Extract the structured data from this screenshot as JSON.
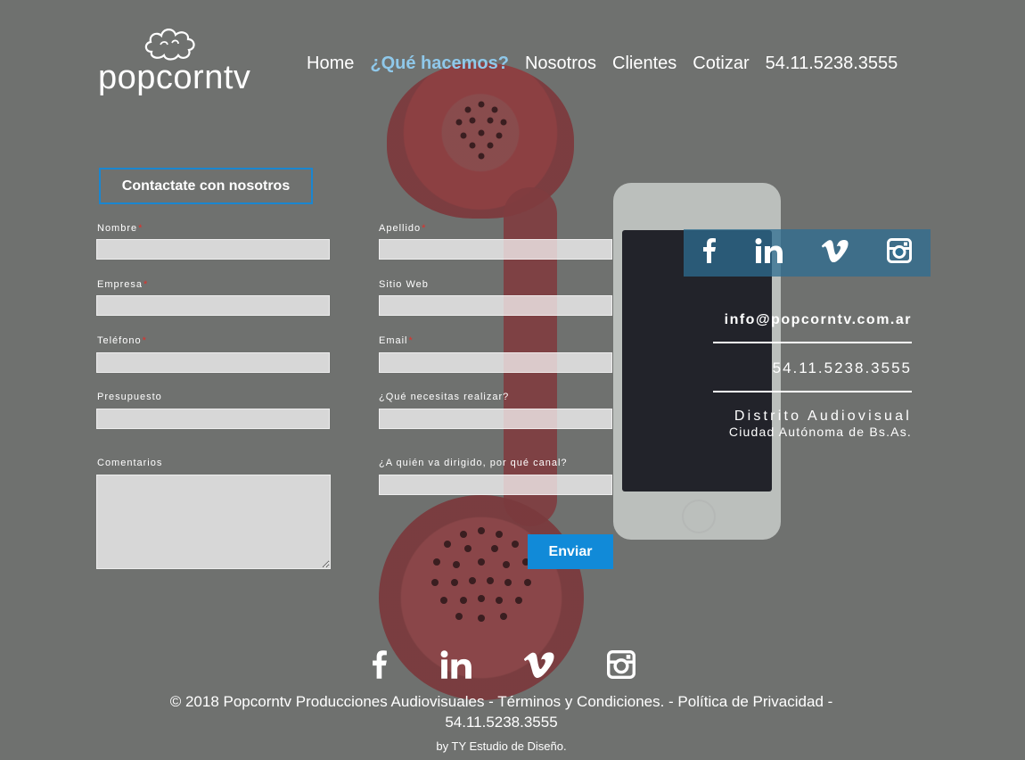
{
  "brand": {
    "name": "popcorntv"
  },
  "nav": {
    "items": [
      {
        "label": "Home"
      },
      {
        "label": "¿Qué hacemos?"
      },
      {
        "label": "Nosotros"
      },
      {
        "label": "Clientes"
      },
      {
        "label": "Cotizar"
      },
      {
        "label": "54.11.5238.3555"
      }
    ],
    "active": "¿Qué hacemos?"
  },
  "form": {
    "title": "Contactate con nosotros",
    "fields": {
      "nombre": {
        "label": "Nombre",
        "required": true,
        "value": ""
      },
      "apellido": {
        "label": "Apellido",
        "required": true,
        "value": ""
      },
      "empresa": {
        "label": "Empresa",
        "required": true,
        "value": ""
      },
      "sitio_web": {
        "label": "Sitio Web",
        "required": false,
        "value": ""
      },
      "telefono": {
        "label": "Teléfono",
        "required": true,
        "value": ""
      },
      "email": {
        "label": "Email",
        "required": true,
        "value": ""
      },
      "presupuesto": {
        "label": "Presupuesto",
        "required": false,
        "value": ""
      },
      "que_necesitas": {
        "label": "¿Qué necesitas realizar?",
        "required": false,
        "value": ""
      },
      "comentarios": {
        "label": "Comentarios",
        "required": false,
        "value": ""
      },
      "a_quien": {
        "label": "¿A quién va dirigido, por qué canal?",
        "required": false,
        "value": ""
      }
    },
    "required_marker": "*",
    "submit_label": "Enviar"
  },
  "contact": {
    "email": "info@popcorntv.com.ar",
    "phone": "54.11.5238.3555",
    "address_line1": "Distrito Audiovisual",
    "address_line2": "Ciudad Autónoma de Bs.As."
  },
  "social": {
    "icons": [
      "facebook-icon",
      "linkedin-icon",
      "vimeo-icon",
      "instagram-icon"
    ],
    "bar_color": "#2d6e91"
  },
  "footer": {
    "copyright": "© 2018 Popcorntv Producciones Audiovisuales  - Términos y Condiciones. - Política de Privacidad -",
    "phone": "54.11.5238.3555",
    "credit": "by TY Estudio de Diseño."
  },
  "colors": {
    "accent": "#118ad8",
    "nav_active": "#8fc8ea",
    "required": "#e0302a"
  }
}
